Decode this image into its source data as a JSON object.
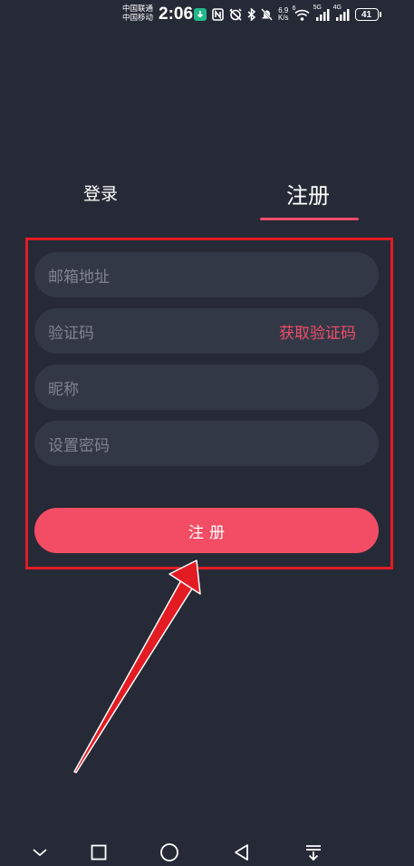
{
  "status_bar": {
    "carrier_1": "中国联通",
    "carrier_2": "中国移动",
    "time": "2:06",
    "net_speed_value": "6.9",
    "net_speed_unit": "K/s",
    "wifi_label": "6",
    "sim1_label": "5G",
    "sim2_label": "4G",
    "battery": "41"
  },
  "tabs": {
    "login": "登录",
    "register": "注册",
    "active": "register"
  },
  "form": {
    "email_placeholder": "邮箱地址",
    "code_placeholder": "验证码",
    "get_code_label": "获取验证码",
    "nickname_placeholder": "昵称",
    "password_placeholder": "设置密码",
    "submit_label": "注册"
  },
  "colors": {
    "background": "#262a36",
    "field": "#333846",
    "accent": "#f04d69",
    "button": "#f24d64",
    "annotation": "#e31c24"
  },
  "nav_icons": [
    "chevron-down-icon",
    "square-icon",
    "circle-icon",
    "triangle-back-icon",
    "menu-down-icon"
  ]
}
